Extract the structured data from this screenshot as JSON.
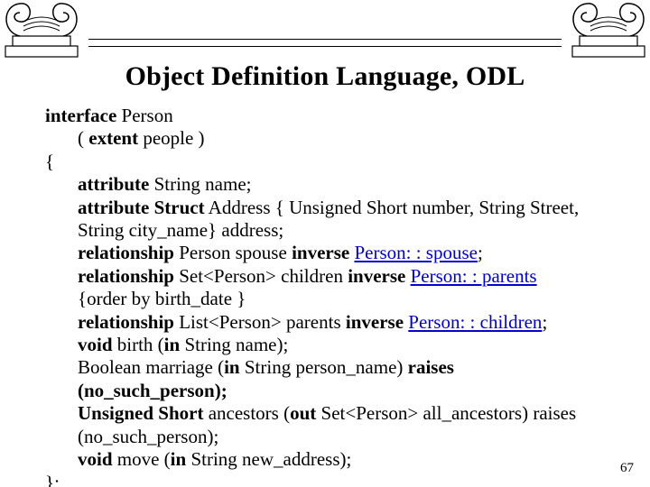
{
  "title": "Object Definition Language, ODL",
  "page_number": "67",
  "code": {
    "kw_interface": "interface",
    "cls": " Person",
    "extent_open": "( ",
    "kw_extent": "extent",
    "extent_rest": " people )",
    "open_brace": "{",
    "attr1_pre": "attribute",
    "attr1_rest": " String name;",
    "attr2_pre": "attribute ",
    "attr2_struct": "Struct",
    "attr2_rest": " Address { Unsigned Short number, String Street, String city_name} address;",
    "rel1_pre": "relationship",
    "rel1_mid": " Person spouse ",
    "rel1_inv": "inverse",
    "rel1_sp": " ",
    "rel1_link": "Person: : spouse",
    "rel1_end": ";",
    "rel2_pre": "relationship",
    "rel2_mid": " Set<Person> children ",
    "rel2_inv": "inverse",
    "rel2_sp": " ",
    "rel2_link": "Person: : parents",
    "rel2_wrap": "{order by birth_date }",
    "rel3_pre": "relationship",
    "rel3_mid": " List<Person> parents ",
    "rel3_inv": "inverse",
    "rel3_sp": " ",
    "rel3_link": "Person: : children",
    "rel3_end": ";",
    "m1_pre": "void",
    "m1_mid": " birth (",
    "m1_in": "in",
    "m1_rest": " String name);",
    "m2_a": "Boolean marriage (",
    "m2_in": "in",
    "m2_b": " String person_name) ",
    "m2_raises": "raises",
    "m2_wrap": "(no_such_person);",
    "m3_a": "Unsigned Short",
    "m3_b": " ancestors (",
    "m3_out": "out",
    "m3_c": " Set<Person> all_ancestors) raises (no_such_person);",
    "m4_pre": "void",
    "m4_mid": " move (",
    "m4_in": "in",
    "m4_rest": " String new_address);",
    "close": "};"
  }
}
